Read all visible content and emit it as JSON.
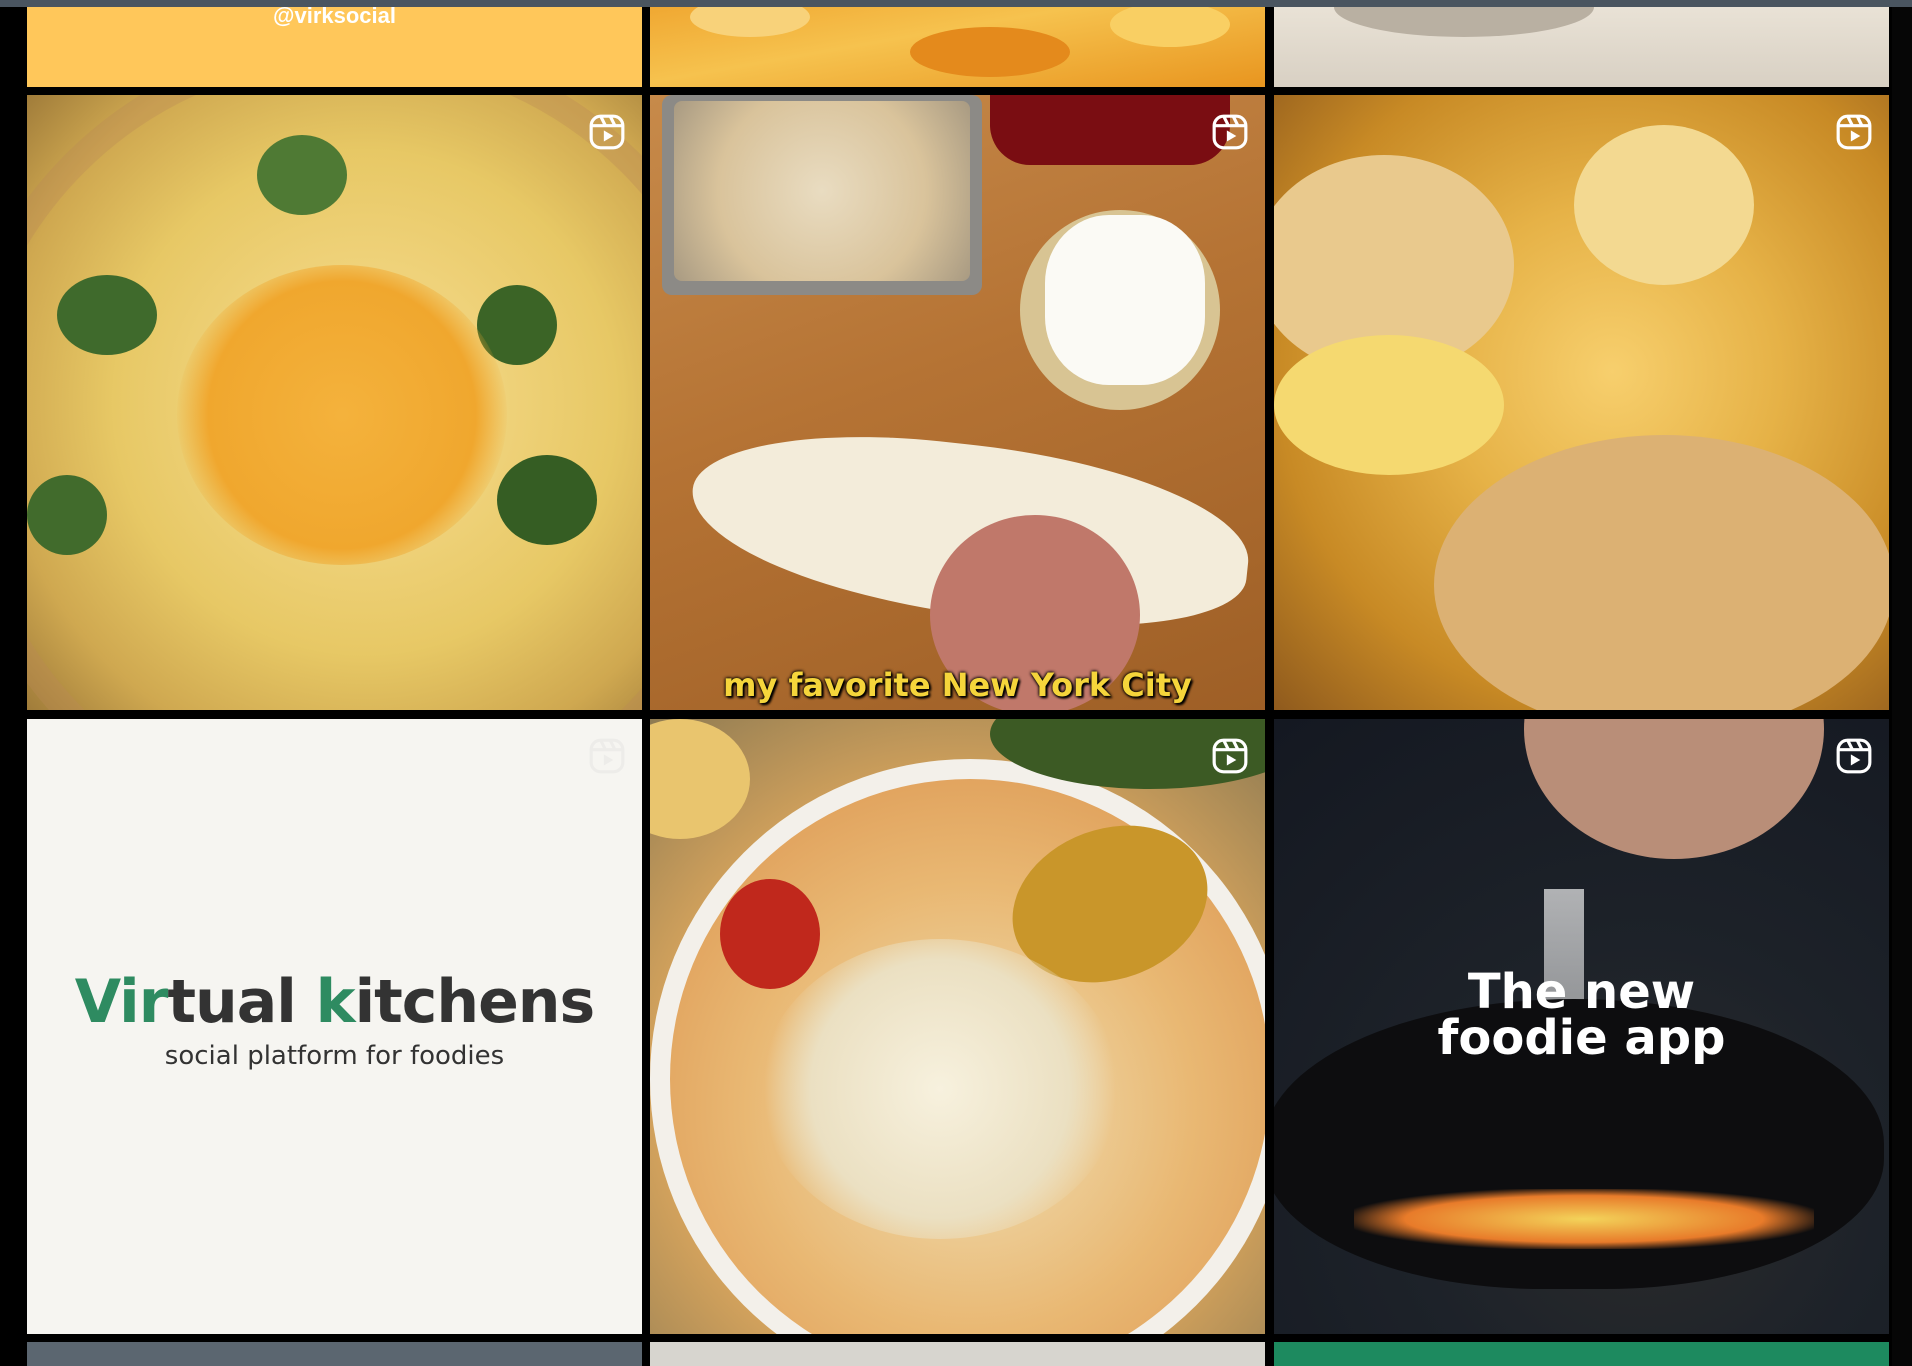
{
  "feed": {
    "handle_text": "@virksocial",
    "brand": {
      "title_part1": "Vir",
      "title_part2": "tual ",
      "title_part3": "k",
      "title_part4": "itchens",
      "subtitle": "social platform for foodies"
    },
    "caption_sandwich": "my favorite New York City",
    "promo_text_line1": "The new",
    "promo_text_line2": "foodie app",
    "colors": {
      "brand_green": "#2e8b61",
      "caption_yellow": "#f5d53b",
      "yellow_tile": "#ffc75a",
      "green_tile": "#1d8a5f"
    },
    "icon": "reels-icon"
  }
}
